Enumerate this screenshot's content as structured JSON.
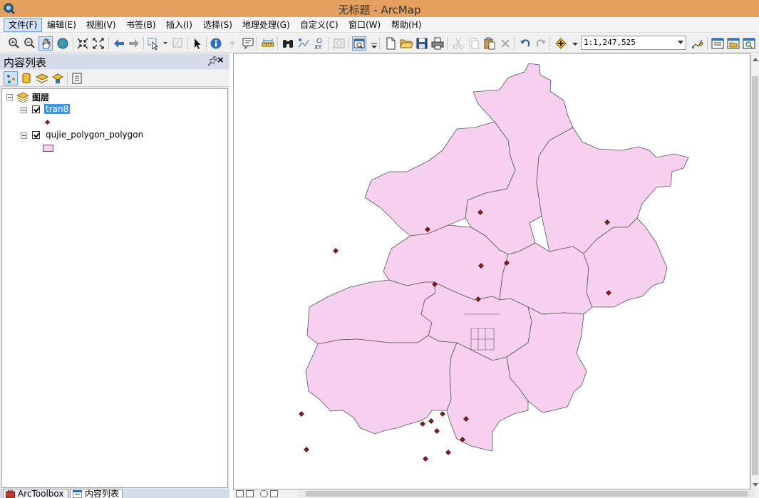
{
  "window": {
    "title": "无标题 - ArcMap"
  },
  "menu": [
    {
      "label": "文件(F)",
      "active": true
    },
    {
      "label": "编辑(E)"
    },
    {
      "label": "视图(V)"
    },
    {
      "label": "书签(B)"
    },
    {
      "label": "插入(I)"
    },
    {
      "label": "选择(S)"
    },
    {
      "label": "地理处理(G)"
    },
    {
      "label": "自定义(C)"
    },
    {
      "label": "窗口(W)"
    },
    {
      "label": "帮助(H)"
    }
  ],
  "toolbar": {
    "scale": "1:1,247,525"
  },
  "toc": {
    "title": "内容列表",
    "root_label": "图层",
    "layers": [
      {
        "name": "tran8",
        "checked": true,
        "selected": true,
        "symbol": "point-marker"
      },
      {
        "name": "qujie_polygon_polygon",
        "checked": true,
        "selected": false,
        "symbol": "polygon-fill"
      }
    ]
  },
  "bottom_tabs": [
    {
      "label": "ArcToolbox"
    },
    {
      "label": "内容列表",
      "active": true
    }
  ],
  "map": {
    "polygon_fill": "#f7d0f0",
    "polygon_stroke": "#555555",
    "point_color": "#8b1a1a",
    "points_count_visible": 17
  }
}
